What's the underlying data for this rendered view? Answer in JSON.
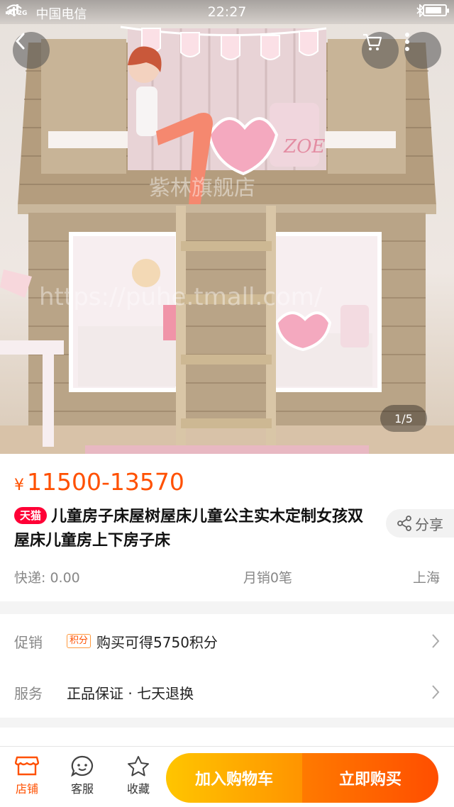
{
  "status_bar": {
    "network": "4G 2G",
    "carrier": "中国电信",
    "time": "22:27",
    "battery_level": 0.85
  },
  "hero": {
    "watermark": "紫林旗舰店",
    "url_watermark": "https://puhe.tmall.com/",
    "pillow_text": "ZOE",
    "image_index": "1/5"
  },
  "product": {
    "currency": "¥",
    "price_range": "11500-13570",
    "store_tag": "天猫",
    "title": "儿童房子床屋树屋床儿童公主实木定制女孩双屋床儿童房上下房子床",
    "share_label": "分享",
    "shipping": "快递: 0.00",
    "monthly_sales": "月销0笔",
    "location": "上海"
  },
  "promotions": {
    "promo_label": "促销",
    "promo_badge": "积分",
    "promo_text": "购买可得5750积分",
    "service_label": "服务",
    "service_text": "正品保证 · 七天退换"
  },
  "bottom_bar": {
    "shop_label": "店铺",
    "cs_label": "客服",
    "fav_label": "收藏",
    "add_to_cart": "加入购物车",
    "buy_now": "立即购买"
  },
  "colors": {
    "accent": "#ff5000",
    "tmall": "#ff0036",
    "cart_gradient": [
      "#ffc500",
      "#ff9400"
    ],
    "buy_gradient": [
      "#ff7a00",
      "#ff4e00"
    ]
  }
}
